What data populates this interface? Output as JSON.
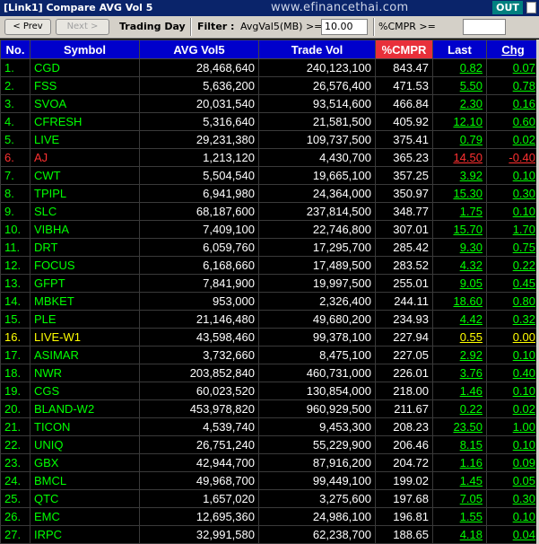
{
  "window": {
    "title": "[Link1] Compare AVG Vol 5",
    "watermark": "www.efinancethai.com",
    "out_label": "OUT"
  },
  "toolbar": {
    "prev_label": "< Prev",
    "next_label": "Next >",
    "mode_label": "Trading Day",
    "filter_label": "Filter :",
    "avgvol_label": "AvgVal5(MB) >=",
    "avgvol_value": "10.00",
    "cmpr_label": "%CMPR >=",
    "cmpr_value": ""
  },
  "table": {
    "headers": [
      "No.",
      "Symbol",
      "AVG Vol5",
      "Trade Vol",
      "%CMPR",
      "Last",
      "Chg"
    ],
    "colors": {
      "up": "#00ff00",
      "down": "#ff3030",
      "unchanged": "#ffff00"
    },
    "rows": [
      {
        "no": "1.",
        "symbol": "CGD",
        "avg": "28,468,640",
        "trade": "240,123,100",
        "cmpr": "843.47",
        "last": "0.82",
        "chg": "0.07",
        "dir": "up"
      },
      {
        "no": "2.",
        "symbol": "FSS",
        "avg": "5,636,200",
        "trade": "26,576,400",
        "cmpr": "471.53",
        "last": "5.50",
        "chg": "0.78",
        "dir": "up"
      },
      {
        "no": "3.",
        "symbol": "SVOA",
        "avg": "20,031,540",
        "trade": "93,514,600",
        "cmpr": "466.84",
        "last": "2.30",
        "chg": "0.16",
        "dir": "up"
      },
      {
        "no": "4.",
        "symbol": "CFRESH",
        "avg": "5,316,640",
        "trade": "21,581,500",
        "cmpr": "405.92",
        "last": "12.10",
        "chg": "0.60",
        "dir": "up"
      },
      {
        "no": "5.",
        "symbol": "LIVE",
        "avg": "29,231,380",
        "trade": "109,737,500",
        "cmpr": "375.41",
        "last": "0.79",
        "chg": "0.02",
        "dir": "up"
      },
      {
        "no": "6.",
        "symbol": "AJ",
        "avg": "1,213,120",
        "trade": "4,430,700",
        "cmpr": "365.23",
        "last": "14.50",
        "chg": "-0.40",
        "dir": "down"
      },
      {
        "no": "7.",
        "symbol": "CWT",
        "avg": "5,504,540",
        "trade": "19,665,100",
        "cmpr": "357.25",
        "last": "3.92",
        "chg": "0.10",
        "dir": "up"
      },
      {
        "no": "8.",
        "symbol": "TPIPL",
        "avg": "6,941,980",
        "trade": "24,364,000",
        "cmpr": "350.97",
        "last": "15.30",
        "chg": "0.30",
        "dir": "up"
      },
      {
        "no": "9.",
        "symbol": "SLC",
        "avg": "68,187,600",
        "trade": "237,814,500",
        "cmpr": "348.77",
        "last": "1.75",
        "chg": "0.10",
        "dir": "up"
      },
      {
        "no": "10.",
        "symbol": "VIBHA",
        "avg": "7,409,100",
        "trade": "22,746,800",
        "cmpr": "307.01",
        "last": "15.70",
        "chg": "1.70",
        "dir": "up"
      },
      {
        "no": "11.",
        "symbol": "DRT",
        "avg": "6,059,760",
        "trade": "17,295,700",
        "cmpr": "285.42",
        "last": "9.30",
        "chg": "0.75",
        "dir": "up"
      },
      {
        "no": "12.",
        "symbol": "FOCUS",
        "avg": "6,168,660",
        "trade": "17,489,500",
        "cmpr": "283.52",
        "last": "4.32",
        "chg": "0.22",
        "dir": "up"
      },
      {
        "no": "13.",
        "symbol": "GFPT",
        "avg": "7,841,900",
        "trade": "19,997,500",
        "cmpr": "255.01",
        "last": "9.05",
        "chg": "0.45",
        "dir": "up"
      },
      {
        "no": "14.",
        "symbol": "MBKET",
        "avg": "953,000",
        "trade": "2,326,400",
        "cmpr": "244.11",
        "last": "18.60",
        "chg": "0.80",
        "dir": "up"
      },
      {
        "no": "15.",
        "symbol": "PLE",
        "avg": "21,146,480",
        "trade": "49,680,200",
        "cmpr": "234.93",
        "last": "4.42",
        "chg": "0.32",
        "dir": "up"
      },
      {
        "no": "16.",
        "symbol": "LIVE-W1",
        "avg": "43,598,460",
        "trade": "99,378,100",
        "cmpr": "227.94",
        "last": "0.55",
        "chg": "0.00",
        "dir": "unchanged"
      },
      {
        "no": "17.",
        "symbol": "ASIMAR",
        "avg": "3,732,660",
        "trade": "8,475,100",
        "cmpr": "227.05",
        "last": "2.92",
        "chg": "0.10",
        "dir": "up"
      },
      {
        "no": "18.",
        "symbol": "NWR",
        "avg": "203,852,840",
        "trade": "460,731,000",
        "cmpr": "226.01",
        "last": "3.76",
        "chg": "0.40",
        "dir": "up"
      },
      {
        "no": "19.",
        "symbol": "CGS",
        "avg": "60,023,520",
        "trade": "130,854,000",
        "cmpr": "218.00",
        "last": "1.46",
        "chg": "0.10",
        "dir": "up"
      },
      {
        "no": "20.",
        "symbol": "BLAND-W2",
        "avg": "453,978,820",
        "trade": "960,929,500",
        "cmpr": "211.67",
        "last": "0.22",
        "chg": "0.02",
        "dir": "up"
      },
      {
        "no": "21.",
        "symbol": "TICON",
        "avg": "4,539,740",
        "trade": "9,453,300",
        "cmpr": "208.23",
        "last": "23.50",
        "chg": "1.00",
        "dir": "up"
      },
      {
        "no": "22.",
        "symbol": "UNIQ",
        "avg": "26,751,240",
        "trade": "55,229,900",
        "cmpr": "206.46",
        "last": "8.15",
        "chg": "0.10",
        "dir": "up"
      },
      {
        "no": "23.",
        "symbol": "GBX",
        "avg": "42,944,700",
        "trade": "87,916,200",
        "cmpr": "204.72",
        "last": "1.16",
        "chg": "0.09",
        "dir": "up"
      },
      {
        "no": "24.",
        "symbol": "BMCL",
        "avg": "49,968,700",
        "trade": "99,449,100",
        "cmpr": "199.02",
        "last": "1.45",
        "chg": "0.05",
        "dir": "up"
      },
      {
        "no": "25.",
        "symbol": "QTC",
        "avg": "1,657,020",
        "trade": "3,275,600",
        "cmpr": "197.68",
        "last": "7.05",
        "chg": "0.30",
        "dir": "up"
      },
      {
        "no": "26.",
        "symbol": "EMC",
        "avg": "12,695,360",
        "trade": "24,986,100",
        "cmpr": "196.81",
        "last": "1.55",
        "chg": "0.10",
        "dir": "up"
      },
      {
        "no": "27.",
        "symbol": "IRPC",
        "avg": "32,991,580",
        "trade": "62,238,700",
        "cmpr": "188.65",
        "last": "4.18",
        "chg": "0.04",
        "dir": "up"
      }
    ]
  }
}
